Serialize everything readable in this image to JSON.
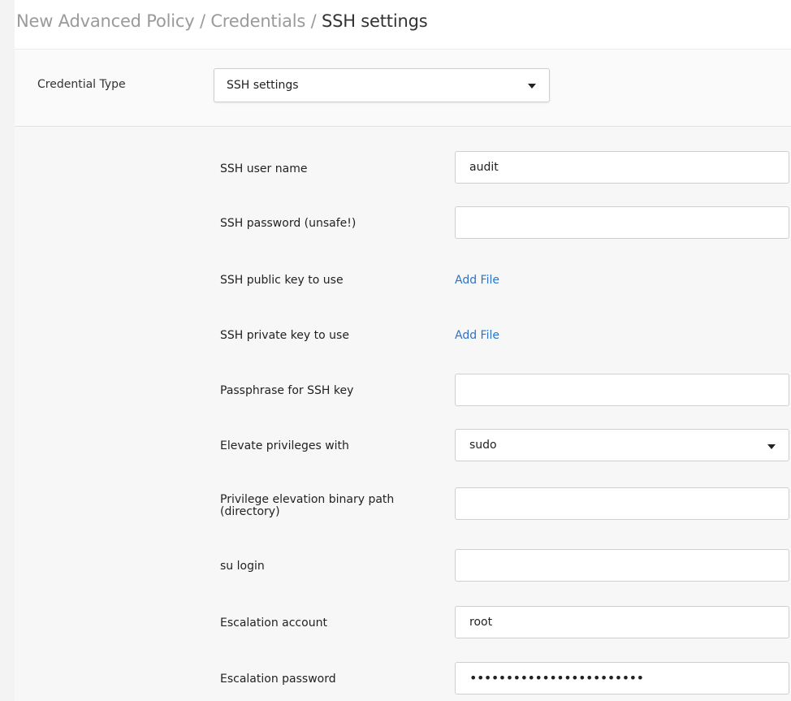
{
  "breadcrumb": {
    "part1": "New Advanced Policy / Credentials / ",
    "current": "SSH settings"
  },
  "credential_type": {
    "label": "Credential Type",
    "selected": "SSH settings"
  },
  "fields": {
    "ssh_user_name": {
      "label": "SSH user name",
      "value": "audit"
    },
    "ssh_password": {
      "label": "SSH password (unsafe!)",
      "value": ""
    },
    "ssh_public_key": {
      "label": "SSH public key to use",
      "link": "Add File"
    },
    "ssh_private_key": {
      "label": "SSH private key to use",
      "link": "Add File"
    },
    "passphrase": {
      "label": "Passphrase for SSH key",
      "value": ""
    },
    "elevate_privileges": {
      "label": "Elevate privileges with",
      "selected": "sudo"
    },
    "elevation_path": {
      "label": "Privilege elevation binary path (directory)",
      "value": ""
    },
    "su_login": {
      "label": "su login",
      "value": ""
    },
    "escalation_account": {
      "label": "Escalation account",
      "value": "root"
    },
    "escalation_password": {
      "label": "Escalation password",
      "value": "••••••••••••••••••••••••"
    }
  },
  "colors": {
    "link": "#2b74c9",
    "panel_bg": "#f7f7f7",
    "header_bg": "#fafafa"
  }
}
